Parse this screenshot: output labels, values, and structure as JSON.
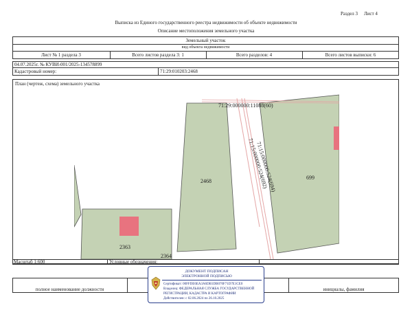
{
  "header": {
    "section_label": "Раздел 3",
    "sheet_label": "Лист 4",
    "title": "Выписка из Единого государственного реестра недвижимости об объекте недвижимости",
    "subtitle": "Описание местоположения земельного участка"
  },
  "object_table": {
    "object_name": "Земельный участок",
    "object_type": "вид объекта недвижимости",
    "sheet_in_section": "Лист № 1 раздела 3",
    "total_sheets_section": "Всего листов раздела 3: 1",
    "total_sections": "Всего разделов: 4",
    "total_sheets_extract": "Всего листов выписки: 6",
    "date_and_number": "04.07.2025г. № КУВИ-001/2025-134578899",
    "cadastral_label": "Кадастровый номер:",
    "cadastral_value": "71:29:010203:2468"
  },
  "plan": {
    "title": "План (чертеж, схема) земельного участка",
    "road_label_top": "71:29:000000:11088(60)",
    "road_label_a": "71:15:000000:524(694)",
    "road_label_b": "71:15:000000:524(692)",
    "parcel_main": "2468",
    "parcel_right": "699",
    "parcel_bottom_left": "2363",
    "parcel_bottom": "2364",
    "colors": {
      "parcel_fill": "#c4d2b4",
      "parcel_stroke": "#555555",
      "accent_red": "#e8737f",
      "road_line": "#e4a5a5"
    }
  },
  "footer": {
    "scale": "Масштаб 1:600",
    "legend": "Условные обозначения:",
    "position_label": "полное наименование должности",
    "name_label": "инициалы, фамилия"
  },
  "signature": {
    "line1": "ДОКУМЕНТ ПОДПИСАН",
    "line2": "ЭЛЕКТРОННОЙ ПОДПИСЬЮ",
    "cert": "Сертификат: 00FFDE6EA3A6DB1DB070F71D7E1CE0",
    "owner": "Владелец: ФЕДЕРАЛЬНАЯ СЛУЖБА ГОСУДАРСТВЕННОЙ",
    "owner2": "РЕГИСТРАЦИИ, КАДАСТРА И КАРТОГРАФИИ",
    "valid": "Действителен: с 02.06.2024 по 26.10.2025"
  }
}
